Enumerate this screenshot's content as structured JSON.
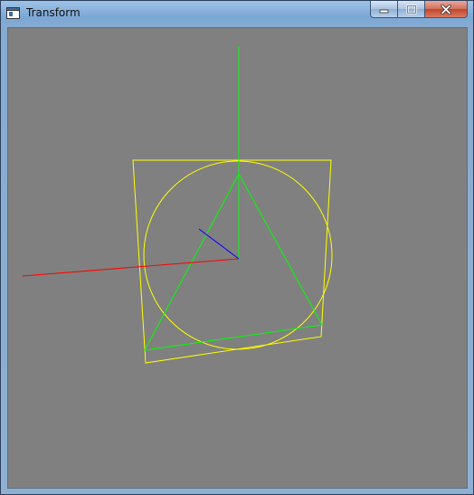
{
  "window": {
    "title": "Transform"
  },
  "icons": {
    "app": "app-window-icon",
    "minimize": "minimize-icon",
    "maximize": "maximize-icon",
    "close": "close-icon"
  },
  "colors": {
    "canvas_background": "#808080",
    "axis_x": "#ff0000",
    "axis_y": "#00ff00",
    "axis_z": "#0000ff",
    "frame": "#ffff00",
    "circle": "#ffff00",
    "triangle": "#00ff00"
  }
}
